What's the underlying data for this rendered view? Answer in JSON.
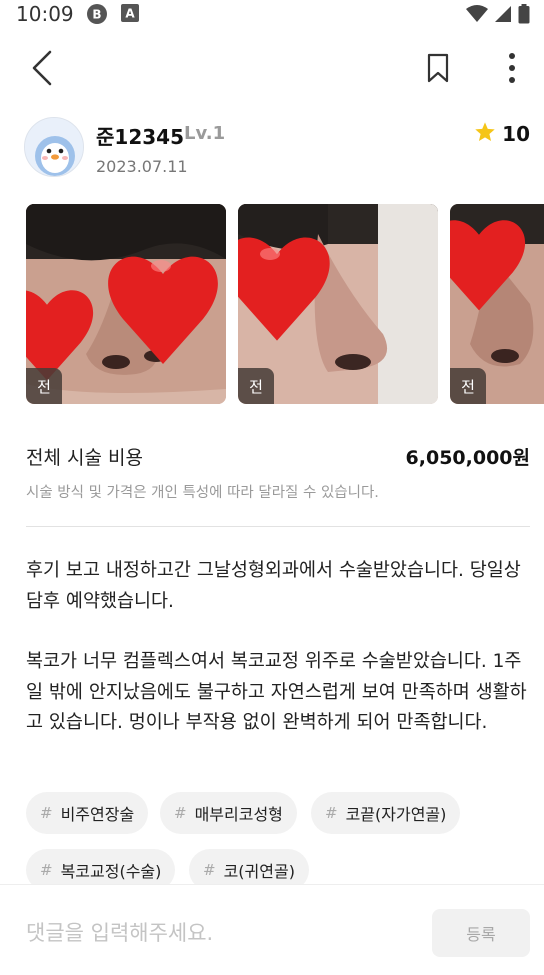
{
  "status_bar": {
    "time": "10:09",
    "b_icon_letter": "B",
    "a_icon_letter": "A"
  },
  "top_bar": {
    "back_icon": "chevron-left-icon",
    "bookmark_icon": "bookmark-icon",
    "more_icon": "more-vertical-icon"
  },
  "author": {
    "name": "준12345",
    "level": "Lv.1",
    "date": "2023.07.11",
    "rating": "10",
    "rating_color": "#f5c518"
  },
  "gallery": {
    "photos": [
      {
        "badge": "전"
      },
      {
        "badge": "전"
      },
      {
        "badge": "전"
      }
    ]
  },
  "cost": {
    "label": "전체 시술 비용",
    "value": "6,050,000원",
    "note": "시술 방식 및 가격은 개인 특성에 따라 달라질 수 있습니다."
  },
  "review": {
    "paragraph_1": "후기 보고 내정하고간 그날성형외과에서 수술받았습니다. 당일상담후 예약했습니다.",
    "paragraph_2": "복코가 너무 컴플렉스여서 복코교정 위주로 수술받았습니다. 1주일 밖에 안지났음에도 불구하고 자연스럽게 보여 만족하며 생활하고 있습니다. 멍이나 부작용 없이 완벽하게 되어 만족합니다."
  },
  "tags": [
    {
      "hash": "#",
      "label": "비주연장술"
    },
    {
      "hash": "#",
      "label": "매부리코성형"
    },
    {
      "hash": "#",
      "label": "코끝(자가연골)"
    },
    {
      "hash": "#",
      "label": "복코교정(수술)"
    },
    {
      "hash": "#",
      "label": "코(귀연골)"
    }
  ],
  "comment": {
    "placeholder": "댓글을 입력해주세요.",
    "submit_label": "등록"
  }
}
